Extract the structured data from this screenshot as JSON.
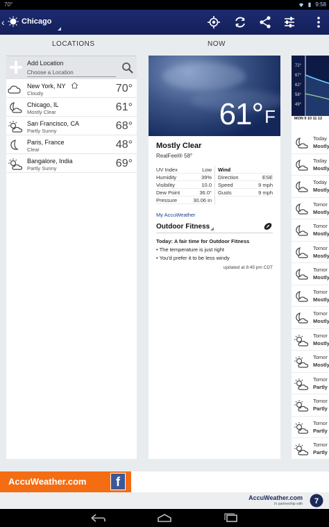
{
  "statusbar": {
    "left_text": "70°",
    "time": "9:58"
  },
  "actionbar": {
    "city": "Chicago"
  },
  "headings": {
    "locations": "LOCATIONS",
    "now": "NOW"
  },
  "add_location": {
    "title": "Add Location",
    "placeholder": "Choose a Location"
  },
  "locations": [
    {
      "name": "New York, NY",
      "cond": "Cloudy",
      "temp": "70°",
      "icon": "cloud-icon",
      "home": true
    },
    {
      "name": "Chicago, IL",
      "cond": "Mostly Clear",
      "temp": "61°",
      "icon": "moon-cloud-icon"
    },
    {
      "name": "San Francisco, CA",
      "cond": "Partly Sunny",
      "temp": "68°",
      "icon": "sun-cloud-icon"
    },
    {
      "name": "Paris, France",
      "cond": "Clear",
      "temp": "48°",
      "icon": "moon-icon"
    },
    {
      "name": "Bangalore, India",
      "cond": "Partly Sunny",
      "temp": "69°",
      "icon": "sun-cloud-icon"
    }
  ],
  "now": {
    "temp": "61°",
    "unit": "F",
    "condition": "Mostly Clear",
    "realfeel": "RealFeel® 58°",
    "stats_left": [
      {
        "label": "UV Index",
        "value": "Low"
      },
      {
        "label": "Humidity",
        "value": "39%"
      },
      {
        "label": "Visibility",
        "value": "10.0"
      },
      {
        "label": "Dew Point",
        "value": "36.0°"
      },
      {
        "label": "Pressure",
        "value": "30.06 in"
      }
    ],
    "wind_title": "Wind",
    "stats_right": [
      {
        "label": "Direction",
        "value": "ESE"
      },
      {
        "label": "Speed",
        "value": "9 mph"
      },
      {
        "label": "Gusts",
        "value": "9 mph"
      }
    ],
    "my_accuweather": "My AccuWeather",
    "fitness_title": "Outdoor Fitness",
    "today_heading": "Today: A fair time for Outdoor Fitness",
    "today_bullets": [
      "• The temperature is just right",
      "• You'd prefer it to be less windy"
    ],
    "updated": "updated at 8:45 pm CDT"
  },
  "graph": {
    "labels": [
      "72°",
      "67°",
      "62°",
      "58°",
      "49°"
    ],
    "days": "MON    9 10 11 12"
  },
  "forecast": [
    {
      "day": "Today",
      "cond": "Mostly",
      "icon": "moon-cloud-icon"
    },
    {
      "day": "Today",
      "cond": "Mostly",
      "icon": "moon-cloud-icon"
    },
    {
      "day": "Today",
      "cond": "Mostly",
      "icon": "moon-cloud-icon"
    },
    {
      "day": "Tomor",
      "cond": "Mostly",
      "icon": "moon-cloud-icon"
    },
    {
      "day": "Tomor",
      "cond": "Mostly",
      "icon": "moon-cloud-icon"
    },
    {
      "day": "Tomor",
      "cond": "Mostly",
      "icon": "moon-cloud-icon"
    },
    {
      "day": "Tomor",
      "cond": "Mostly",
      "icon": "moon-cloud-icon"
    },
    {
      "day": "Tomor",
      "cond": "Mostly",
      "icon": "moon-cloud-icon"
    },
    {
      "day": "Tomor",
      "cond": "Mostly",
      "icon": "moon-cloud-icon"
    },
    {
      "day": "Tomor",
      "cond": "Mostly",
      "icon": "sun-cloud-icon"
    },
    {
      "day": "Tomor",
      "cond": "Mostly",
      "icon": "sun-cloud-icon"
    },
    {
      "day": "Tomor",
      "cond": "Partly",
      "icon": "sun-cloud-icon"
    },
    {
      "day": "Tomor",
      "cond": "Partly",
      "icon": "sun-cloud-icon"
    },
    {
      "day": "Tomor",
      "cond": "Partly",
      "icon": "sun-cloud-icon"
    },
    {
      "day": "Tomor",
      "cond": "Partly",
      "icon": "sun-cloud-icon"
    }
  ],
  "ad": {
    "brand": "AccuWeather.com",
    "fb": "f"
  },
  "partner": {
    "brand": "AccuWeather.com",
    "sub": "In partnership with"
  },
  "colors": {
    "actionbar": "#1d2a6e",
    "ad_orange": "#f46d12",
    "facebook": "#3b5998"
  }
}
